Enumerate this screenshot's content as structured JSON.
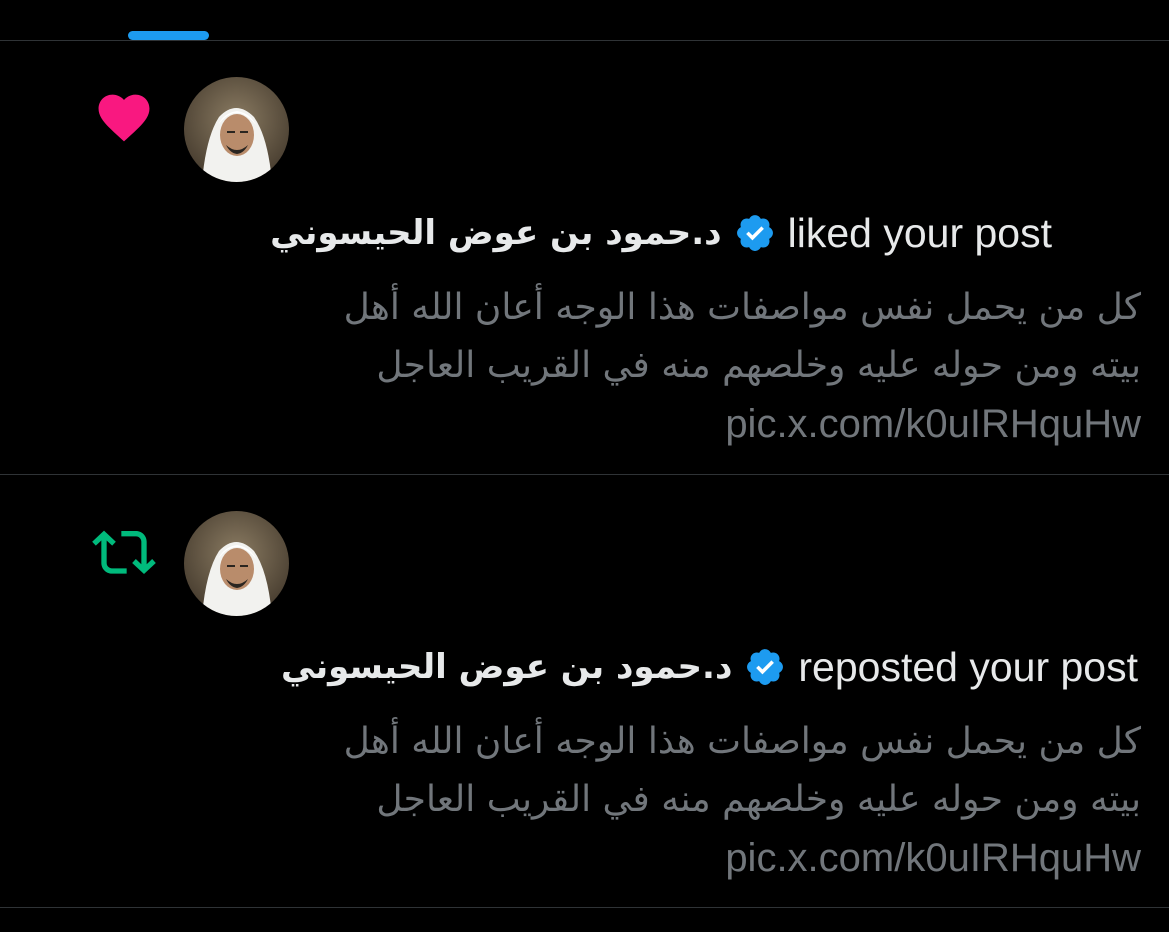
{
  "tabs": {
    "active_indicator_color": "#1d9bf0"
  },
  "colors": {
    "background": "#000000",
    "primary_text": "#e7e9ea",
    "secondary_text": "#71767b",
    "like": "#f91880",
    "repost": "#00ba7c",
    "verified": "#1d9bf0",
    "divider": "#2f3336"
  },
  "notifications": [
    {
      "type": "like",
      "icon": "heart-icon",
      "user_name": "د.حمود بن عوض الحيسوني",
      "verified_icon": "verified-badge-icon",
      "action": "liked your post",
      "post_lines": [
        "كل من يحمل نفس مواصفات هذا الوجه أعان الله أهل",
        "بيته ومن حوله عليه وخلصهم منه في القريب العاجل"
      ],
      "link": "pic.x.com/k0uIRHquHw"
    },
    {
      "type": "repost",
      "icon": "repost-icon",
      "user_name": "د.حمود بن عوض الحيسوني",
      "verified_icon": "verified-badge-icon",
      "action": "reposted your post",
      "post_lines": [
        "كل من يحمل نفس مواصفات هذا الوجه أعان الله أهل",
        "بيته ومن حوله عليه وخلصهم منه في القريب العاجل"
      ],
      "link": "pic.x.com/k0uIRHquHw"
    }
  ]
}
